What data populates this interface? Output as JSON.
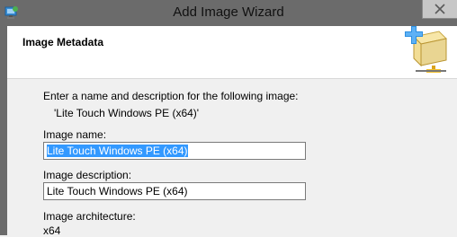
{
  "window": {
    "title": "Add Image Wizard",
    "icon": "wizard-app-icon",
    "close_icon": "close-icon"
  },
  "header": {
    "page_title": "Image Metadata",
    "icon": "image-add-icon"
  },
  "content": {
    "instruction": "Enter a name and description for the following image:",
    "source_image": "'Lite Touch Windows PE (x64)'",
    "image_name_label": "Image name:",
    "image_name_value": "Lite Touch Windows PE (x64)",
    "image_description_label": "Image description:",
    "image_description_value": "Lite Touch Windows PE (x64)",
    "image_architecture_label": "Image architecture:",
    "image_architecture_value": "x64"
  },
  "colors": {
    "titlebar": "#6b6b6b",
    "selection": "#3399ff"
  }
}
